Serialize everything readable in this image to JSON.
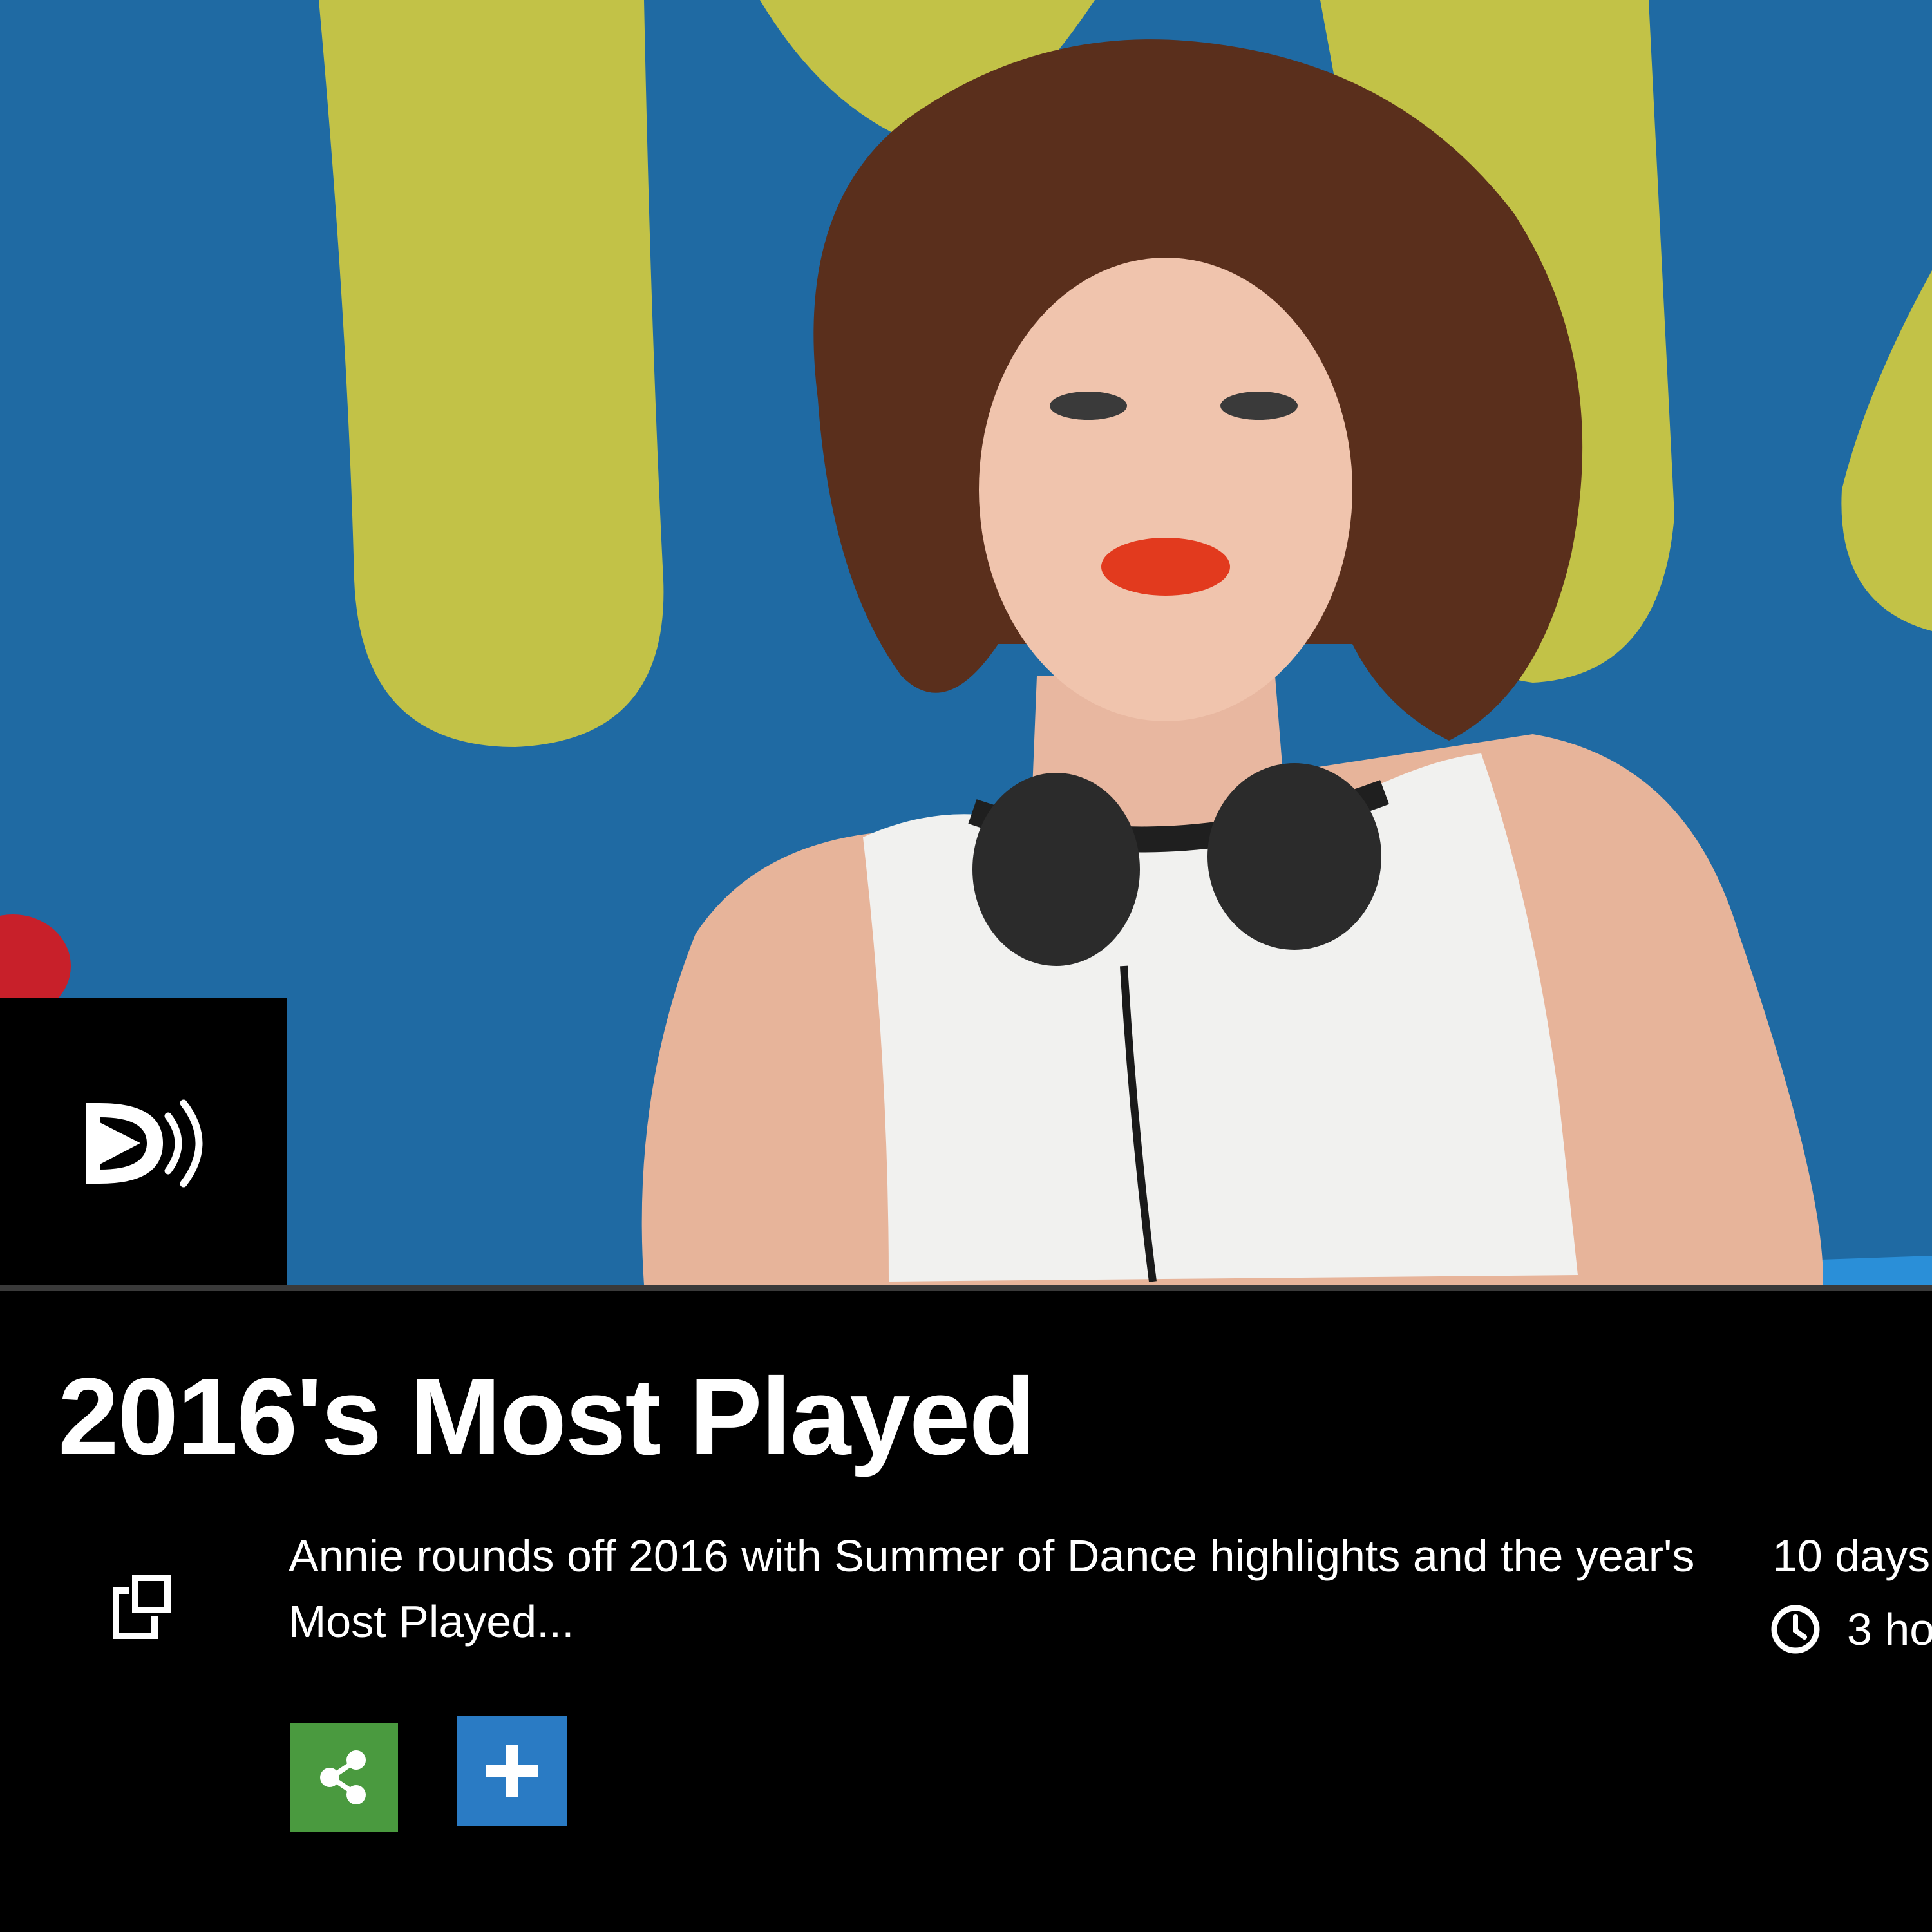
{
  "episode": {
    "title": "2016's Most Played",
    "description": "Annie rounds off 2016 with Summer of Dance highlights and the year's Most Played...",
    "availability": "10 days",
    "duration": "3 ho"
  },
  "hero": {
    "image_alt": "Woman with curly hair and headphones around her neck on stage",
    "background_color": "#1f6aa3",
    "accent_color": "#c2c247"
  },
  "icons": {
    "media_type": "audio-play-icon",
    "external_link": "external-link-icon",
    "clock": "clock-icon",
    "share": "share-icon",
    "add": "plus-icon"
  },
  "colors": {
    "share_button": "#4a9a3f",
    "add_button": "#2a7bc4"
  }
}
